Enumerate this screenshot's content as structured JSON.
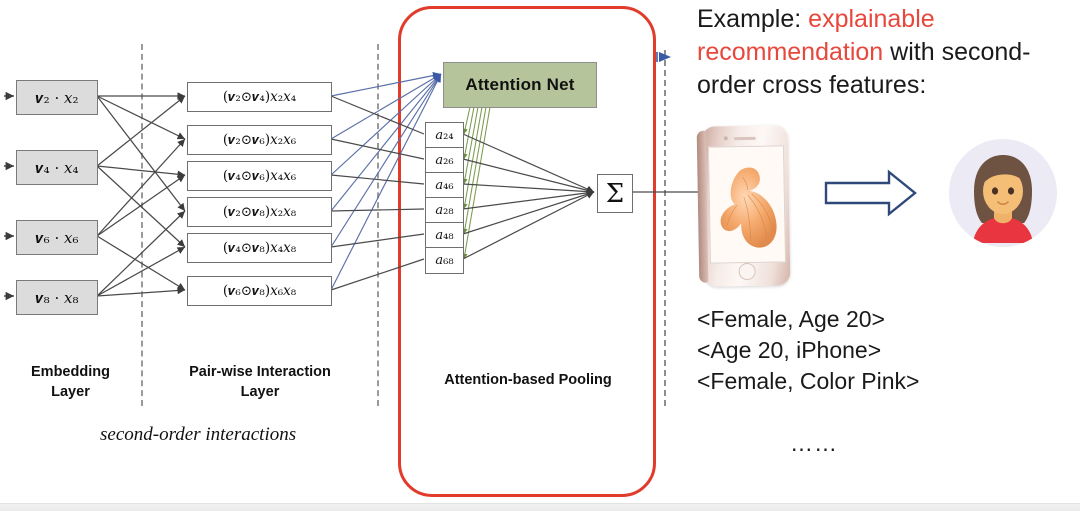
{
  "diagram": {
    "embedding_layer": {
      "caption": "Embedding\nLayer",
      "caption_line1": "Embedding",
      "caption_line2": "Layer",
      "nodes": [
        {
          "label": "𝒗₂ · 𝑥₂",
          "plain": "v2 · x2"
        },
        {
          "label": "𝒗₄ · 𝑥₄",
          "plain": "v4 · x4"
        },
        {
          "label": "𝒗₆ · 𝑥₆",
          "plain": "v6 · x6"
        },
        {
          "label": "𝒗₈ · 𝑥₈",
          "plain": "v8 · x8"
        }
      ]
    },
    "pairwise_layer": {
      "caption_line1": "Pair-wise Interaction",
      "caption_line2": "Layer",
      "nodes": [
        {
          "label": "(𝒗₂⊙𝒗₄)𝑥₂𝑥₄"
        },
        {
          "label": "(𝒗₂⊙𝒗₆)𝑥₂𝑥₆"
        },
        {
          "label": "(𝒗₄⊙𝒗₆)𝑥₄𝑥₆"
        },
        {
          "label": "(𝒗₂⊙𝒗₈)𝑥₂𝑥₈"
        },
        {
          "label": "(𝒗₄⊙𝒗₈)𝑥₄𝑥₈"
        },
        {
          "label": "(𝒗₆⊙𝒗₈)𝑥₆𝑥₈"
        }
      ]
    },
    "pooling": {
      "caption": "Attention-based Pooling",
      "attention_net_label": "Attention Net",
      "sum_symbol": "Σ",
      "attention_weights": [
        {
          "label": "𝑎₂₄"
        },
        {
          "label": "𝑎₂₆"
        },
        {
          "label": "𝑎₄₆"
        },
        {
          "label": "𝑎₂₈"
        },
        {
          "label": "𝑎₄₈"
        },
        {
          "label": "𝑎₆₈"
        }
      ]
    },
    "footnote": "second-order interactions",
    "colors": {
      "attention_net_fill": "#b6c49b",
      "highlight_border": "#e13b2b",
      "embedding_fill": "#dcdcdc",
      "blue_edges": "#5b6fa8",
      "green_edges": "#7c9a4e",
      "gray_edges": "#555555"
    }
  },
  "right_panel": {
    "headline": {
      "prefix": "Example: ",
      "emphasis": "explainable recommendation",
      "suffix": " with second-order cross features:"
    },
    "illustration": {
      "product_alt": "iPhone product photo",
      "arrow_alt": "right arrow",
      "user_alt": "female user avatar"
    },
    "cross_features": [
      "<Female, Age 20>",
      "<Age 20, iPhone>",
      "<Female, Color Pink>"
    ],
    "ellipsis": "……"
  }
}
